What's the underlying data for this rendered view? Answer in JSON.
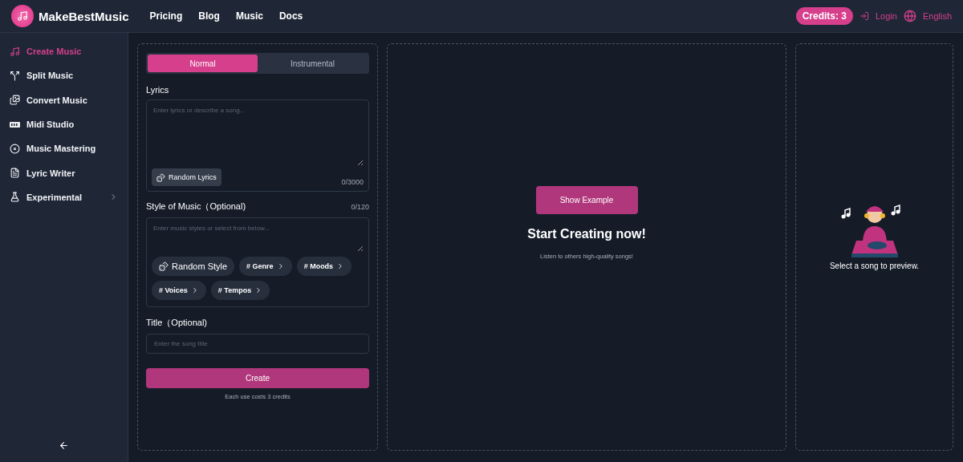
{
  "header": {
    "brand": "MakeBestMusic",
    "nav": [
      "Pricing",
      "Blog",
      "Music",
      "Docs"
    ],
    "credits": "Credits: 3",
    "login": "Login",
    "language": "English"
  },
  "sidebar": {
    "items": [
      {
        "label": "Create Music",
        "selected": true,
        "kind": "link"
      },
      {
        "label": "Split Music",
        "selected": false,
        "kind": "link"
      },
      {
        "label": "Convert Music",
        "selected": false,
        "kind": "link"
      },
      {
        "label": "Midi Studio",
        "selected": false,
        "kind": "link"
      },
      {
        "label": "Music Mastering",
        "selected": false,
        "kind": "link"
      },
      {
        "label": "Lyric Writer",
        "selected": false,
        "kind": "link"
      },
      {
        "label": "Experimental",
        "selected": false,
        "kind": "group"
      }
    ]
  },
  "form": {
    "tabs": [
      {
        "label": "Normal",
        "selected": true
      },
      {
        "label": "Instrumental",
        "selected": false
      }
    ],
    "lyrics": {
      "label": "Lyrics",
      "placeholder": "Enter lyrics or describe a song...",
      "random_button": "Random Lyrics",
      "counter": "0/3000"
    },
    "style": {
      "label": "Style of Music（Optional)",
      "counter": "0/120",
      "placeholder": "Enter music styles or select from below...",
      "random_button": "Random Style",
      "tags": [
        "# Genre",
        "# Moods",
        "# Voices",
        "# Tempos"
      ]
    },
    "title": {
      "label": "Title（Optional)",
      "placeholder": "Enter the song title"
    },
    "create_button": "Create",
    "cost_note": "Each use costs 3 credits"
  },
  "showcase": {
    "button": "Show Example",
    "heading": "Start Creating now!",
    "subtext": "Listen to others high-quality songs!"
  },
  "preview": {
    "caption": "Select a song to preview."
  }
}
